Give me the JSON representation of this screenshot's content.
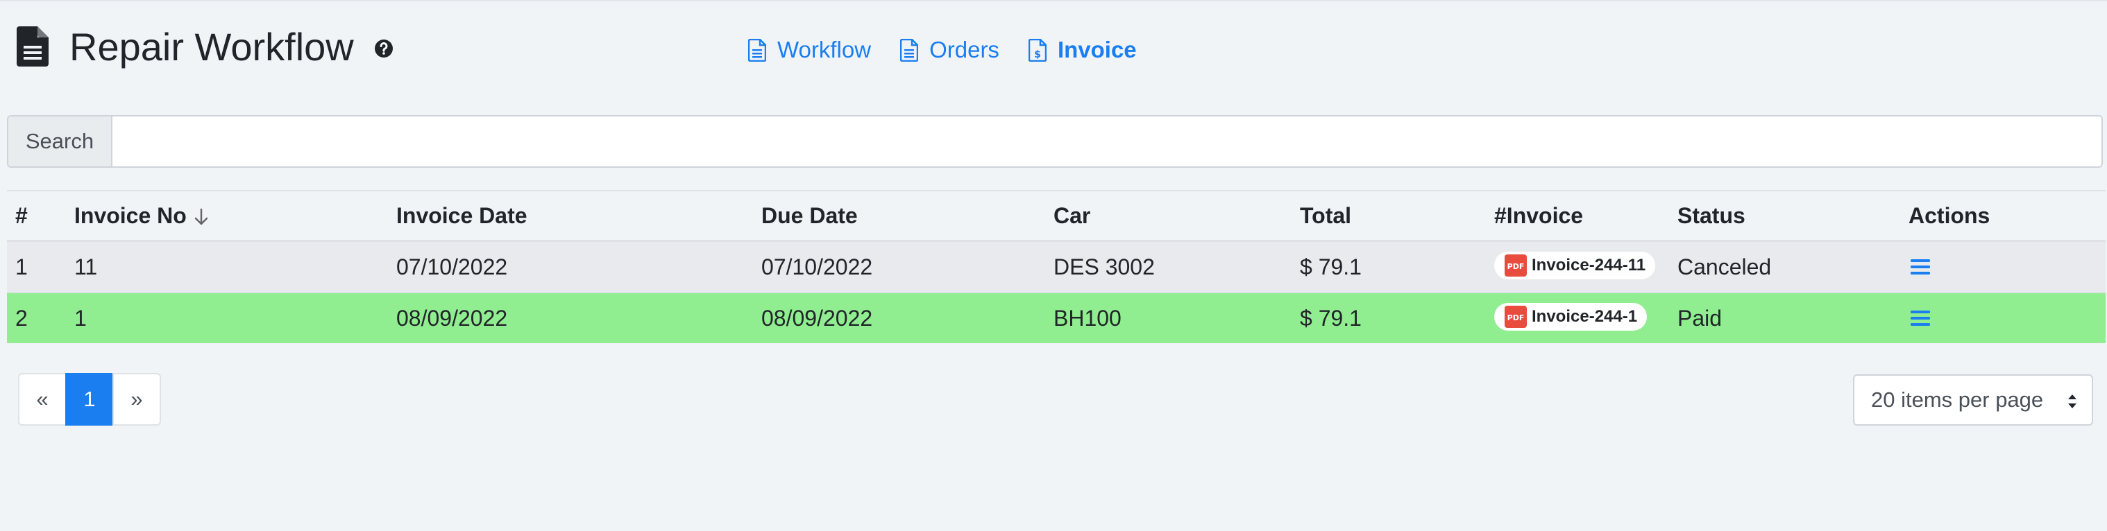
{
  "header": {
    "title": "Repair Workflow",
    "nav": [
      {
        "label": "Workflow",
        "icon": "file-alt-icon",
        "active": false
      },
      {
        "label": "Orders",
        "icon": "file-alt-icon",
        "active": false
      },
      {
        "label": "Invoice",
        "icon": "file-invoice-dollar-icon",
        "active": true
      }
    ]
  },
  "search": {
    "label": "Search",
    "value": "",
    "placeholder": ""
  },
  "table": {
    "columns": [
      "#",
      "Invoice No",
      "Invoice Date",
      "Due Date",
      "Car",
      "Total",
      "#Invoice",
      "Status",
      "Actions"
    ],
    "sort_column": "Invoice No",
    "sort_direction": "desc",
    "rows": [
      {
        "num": "1",
        "invoice_no": "11",
        "invoice_date": "07/10/2022",
        "due_date": "07/10/2022",
        "car": "DES 3002",
        "total": "$ 79.1",
        "invoice": "Invoice-244-11",
        "status": "Canceled"
      },
      {
        "num": "2",
        "invoice_no": "1",
        "invoice_date": "08/09/2022",
        "due_date": "08/09/2022",
        "car": "BH100",
        "total": "$ 79.1",
        "invoice": "Invoice-244-1",
        "status": "Paid"
      }
    ]
  },
  "pagination": {
    "prev": "«",
    "pages": [
      "1"
    ],
    "current": "1",
    "next": "»"
  },
  "per_page": {
    "selected": "20 items per page"
  },
  "colors": {
    "accent": "#1a7ef0",
    "paid_row": "#90ee90",
    "canceled_row": "#e9eaed",
    "pdf_red": "#e74c3c",
    "background": "#f1f4f7"
  }
}
